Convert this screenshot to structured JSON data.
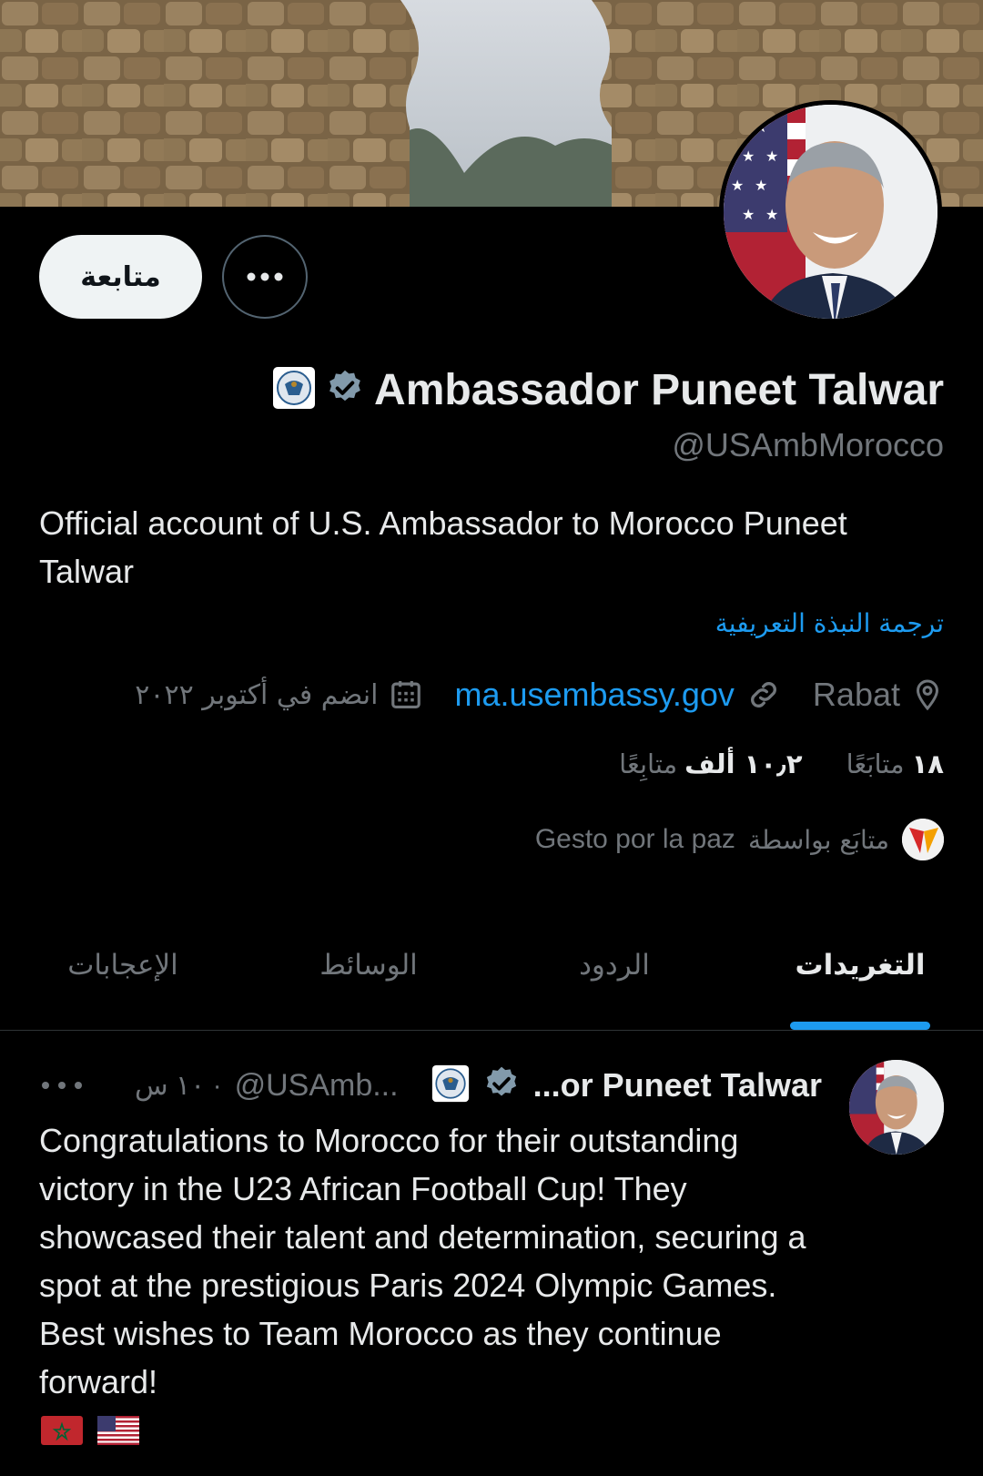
{
  "profile": {
    "follow_label": "متابعة",
    "display_name": "Ambassador Puneet Talwar",
    "handle": "@USAmbMorocco",
    "bio": "Official account of U.S. Ambassador to Morocco Puneet Talwar",
    "translate_bio": "ترجمة النبذة التعريفية",
    "location": "Rabat",
    "website": "ma.usembassy.gov",
    "joined": "انضم في أكتوبر ٢٠٢٢",
    "following_count": "١٨",
    "following_label": "متابَعًا",
    "followers_count": "١٠٫٢ ألف",
    "followers_label": "متابِعًا",
    "followed_by_prefix": "متابَع بواسطة",
    "followed_by_name": "Gesto por la paz",
    "verified": true,
    "affiliation_badge": "us-embassy-seal"
  },
  "tabs": [
    {
      "label": "التغريدات",
      "active": true
    },
    {
      "label": "الردود",
      "active": false
    },
    {
      "label": "الوسائط",
      "active": false
    },
    {
      "label": "الإعجابات",
      "active": false
    }
  ],
  "tweet": {
    "name": "...or Puneet Talwar",
    "handle": "@USAmb...",
    "time": "١٠ س",
    "separator": "·",
    "text": "Congratulations to Morocco for their outstanding victory in the U23 African Football Cup! They showcased their talent and determination, securing a spot at the prestigious Paris 2024 Olympic Games. Best wishes to Team Morocco as they continue forward!",
    "emoji_flags": [
      "morocco-flag",
      "usa-flag"
    ]
  },
  "colors": {
    "background": "#000000",
    "accent": "#1d9bf0",
    "secondary_text": "#71767b",
    "primary_text": "#e7e9ea"
  }
}
